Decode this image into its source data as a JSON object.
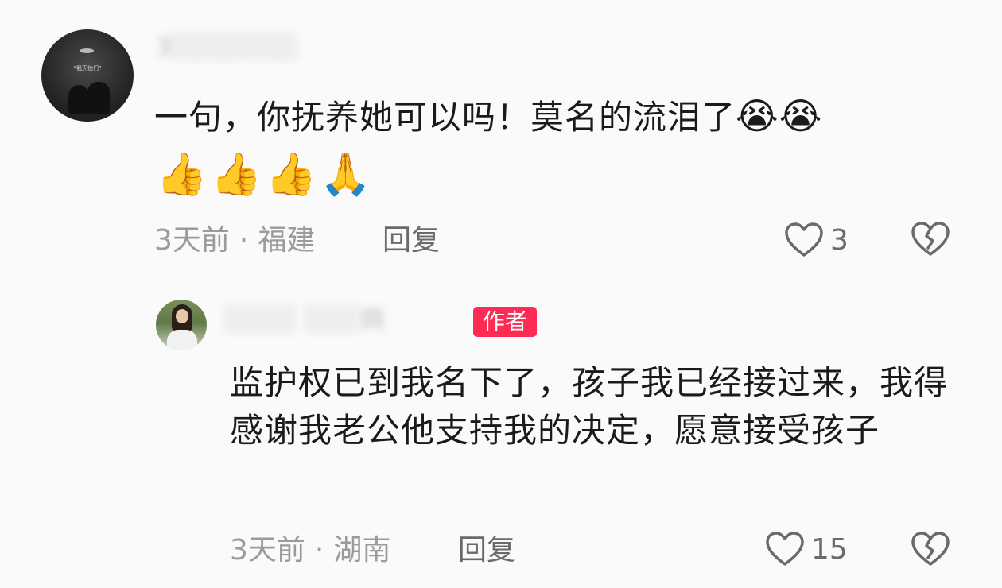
{
  "comments": [
    {
      "username": "3░░░░░░░",
      "text": "一句，你抚养她可以吗！莫名的流泪了",
      "inline_emojis": [
        "😭",
        "😭"
      ],
      "emoji_row": [
        "👍",
        "👍",
        "👍",
        "🙏"
      ],
      "time": "3天前",
      "separator": "·",
      "location": "福建",
      "reply_label": "回复",
      "likes": "3",
      "avatar_caption": "“我天他们”"
    },
    {
      "username": "░░░░ ░░░鸽",
      "author_badge": "作者",
      "text": "监护权已到我名下了，孩子我已经接过来，我得感谢我老公他支持我的决定，愿意接受孩子",
      "time": "3天前",
      "separator": "·",
      "location": "湖南",
      "reply_label": "回复",
      "likes": "15"
    }
  ],
  "icons": {
    "like": "heart-outline-icon",
    "dislike": "broken-heart-icon"
  },
  "colors": {
    "author_badge": "#fe2c55",
    "meta": "#9b9b9b",
    "background": "#fafafa"
  }
}
